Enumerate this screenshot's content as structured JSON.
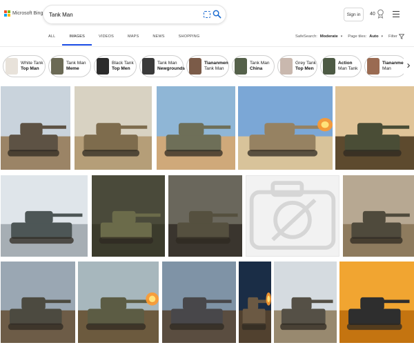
{
  "header": {
    "logo_text": "Microsoft Bing",
    "search_value": "Tank Man",
    "signin_label": "Sign in",
    "points": "40"
  },
  "tabs": [
    {
      "label": "ALL",
      "active": false
    },
    {
      "label": "IMAGES",
      "active": true
    },
    {
      "label": "VIDEOS",
      "active": false
    },
    {
      "label": "MAPS",
      "active": false
    },
    {
      "label": "NEWS",
      "active": false
    },
    {
      "label": "SHOPPING",
      "active": false
    }
  ],
  "filters": {
    "safesearch_label": "SafeSearch:",
    "safesearch_value": "Moderate",
    "pagetiles_label": "Page tiles:",
    "pagetiles_value": "Auto",
    "filter_label": "Filter"
  },
  "chips": [
    {
      "line1": "White Tank",
      "line2": "Top Man",
      "bold_line": 2,
      "thumb_color": "#e8e2da"
    },
    {
      "line1": "Tank Man",
      "line2": "Meme",
      "bold_line": 2,
      "thumb_color": "#6b6a55"
    },
    {
      "line1": "Black Tank",
      "line2": "Top Men",
      "bold_line": 2,
      "thumb_color": "#2b2b2b"
    },
    {
      "line1": "Tank Man",
      "line2": "Newgrounds",
      "bold_line": 2,
      "thumb_color": "#3a3a3a"
    },
    {
      "line1": "Tiananmen",
      "line2": "Tank Man",
      "bold_line": 1,
      "thumb_color": "#7b5b48"
    },
    {
      "line1": "Tank Man",
      "line2": "China",
      "bold_line": 2,
      "thumb_color": "#55614a"
    },
    {
      "line1": "Grey Tank",
      "line2": "Top Men",
      "bold_line": 2,
      "thumb_color": "#c9b8ae"
    },
    {
      "line1": "Action",
      "line2": "Man Tank",
      "bold_line": 1,
      "thumb_color": "#4d5a44"
    },
    {
      "line1": "Tiananmen Sq",
      "line2": "Man",
      "bold_line": 1,
      "thumb_color": "#9a6b52"
    }
  ],
  "images": [
    {
      "sky": "#c9d3dc",
      "ground": "#9b8466",
      "tank": "#5d5244"
    },
    {
      "sky": "#d8d2c2",
      "ground": "#b59e78",
      "tank": "#7e6c4d"
    },
    {
      "sky": "#8fb6d6",
      "ground": "#cfa97a",
      "tank": "#6e6f58"
    },
    {
      "sky": "#7ba7d6",
      "ground": "#d8c39a",
      "tank": "#968262",
      "fire": true
    },
    {
      "sky": "#e0c498",
      "ground": "#5d4a2e",
      "tank": "#4a4d36"
    },
    {
      "sky": "#dfe5ea",
      "ground": "#a6aeb4",
      "tank": "#4d5656"
    },
    {
      "sky": "#4a4a3a",
      "ground": "#3b3b2c",
      "tank": "#6b6b4a"
    },
    {
      "sky": "#6a675c",
      "ground": "#3a352e",
      "tank": "#55503f"
    },
    {
      "placeholder": true
    },
    {
      "sky": "#b7a892",
      "ground": "#8e7b5e",
      "tank": "#4f4a3c"
    },
    {
      "sky": "#9aa7b3",
      "ground": "#6d5c47",
      "tank": "#4c4a40"
    },
    {
      "sky": "#a7b7bd",
      "ground": "#6c5a3e",
      "tank": "#5c5c44",
      "fire": true
    },
    {
      "sky": "#7f93a6",
      "ground": "#5a4d40",
      "tank": "#48474a"
    },
    {
      "sky": "#1a2d46",
      "ground": "#51412f",
      "tank": "#6b5943",
      "fire": true
    },
    {
      "sky": "#d5dbe0",
      "ground": "#98896f",
      "tank": "#555046"
    },
    {
      "sky": "#f1a531",
      "ground": "#c47410",
      "tank": "#2e2e2e"
    }
  ]
}
